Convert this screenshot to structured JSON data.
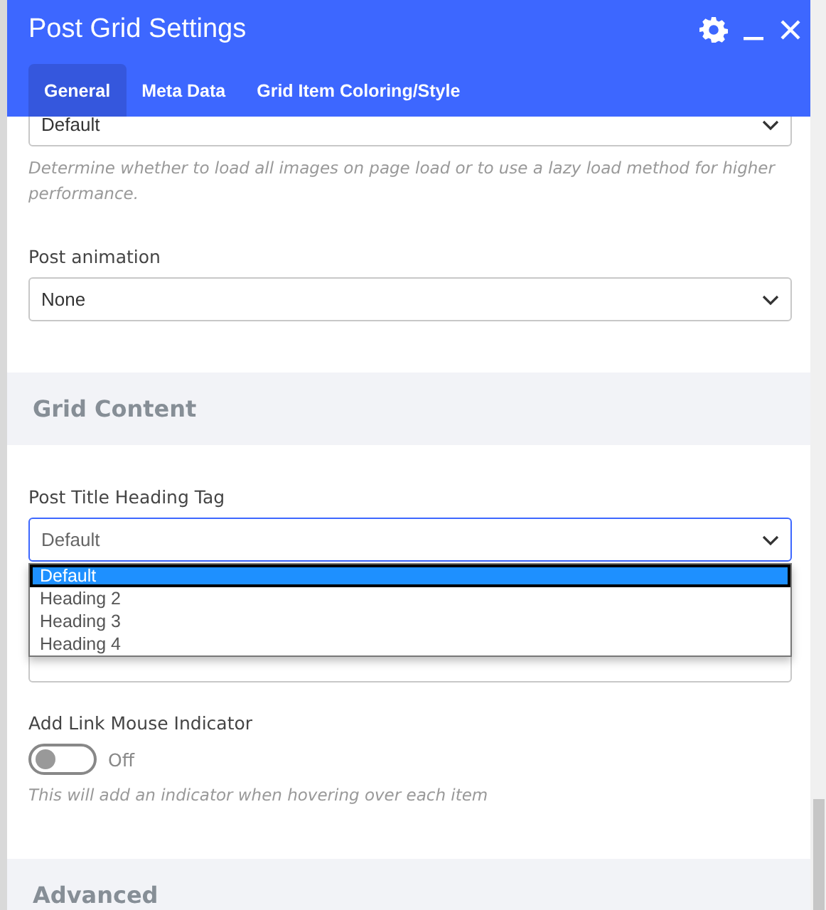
{
  "window": {
    "title": "Post Grid Settings"
  },
  "tabs": [
    {
      "label": "General",
      "selected": true
    },
    {
      "label": "Meta Data",
      "selected": false
    },
    {
      "label": "Grid Item Coloring/Style",
      "selected": false
    }
  ],
  "items": [
    {
      "kind": "select",
      "value": "Default",
      "help": "Determine whether to load all images on page load or to use a lazy load method for higher performance."
    },
    {
      "kind": "select",
      "label": "Post animation",
      "value": "None"
    },
    {
      "kind": "heading",
      "title": "Grid Content"
    },
    {
      "kind": "select",
      "label": "Post Title Heading Tag",
      "value": "Default",
      "focused": true,
      "options": [
        {
          "label": "Default",
          "selected": true
        },
        {
          "label": "Heading 2",
          "selected": false
        },
        {
          "label": "Heading 3",
          "selected": false
        },
        {
          "label": "Heading 4",
          "selected": false
        }
      ]
    },
    {
      "kind": "select"
    },
    {
      "kind": "toggle",
      "label": "Add Link Mouse Indicator",
      "on": false,
      "state_text": "Off",
      "help": "This will add an indicator when hovering over each item"
    },
    {
      "kind": "heading",
      "title": "Advanced"
    }
  ]
}
